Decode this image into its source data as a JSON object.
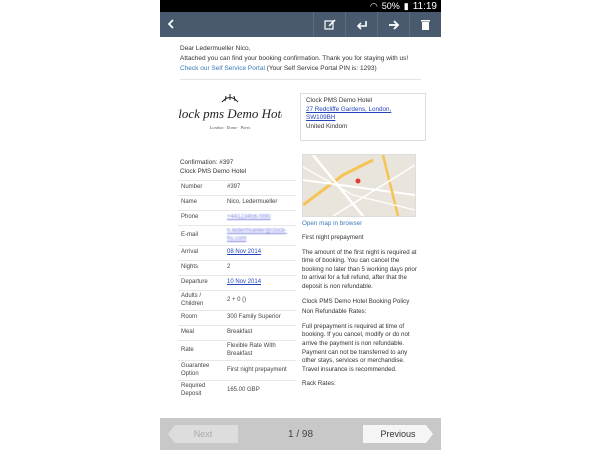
{
  "status": {
    "battery": "50%",
    "time": "11:19"
  },
  "toolbar": {
    "back_icon": "chevron-left-icon"
  },
  "email": {
    "greeting": "Dear Ledermueller Nico,",
    "intro": "Attached you can find your booking confirmation. Thank you for staying with us!",
    "portal_link": "Check our Self Service Portal",
    "portal_pin": " (Your Self Service Portal PIN is: 1293)"
  },
  "hotel": {
    "logo_text": "Clock pms Demo Hotel",
    "logo_sub": "London · Rome · Paris",
    "name": "Clock PMS Demo Hotel",
    "address_line1": "27 Redcliffe Gardens, London,",
    "address_line2": "SW109BH",
    "country": "United Kindom"
  },
  "confirmation": {
    "number_label": "Confirmation: #397",
    "hotel": "Clock PMS Demo Hotel"
  },
  "details": [
    {
      "key": "Number",
      "value": "#397"
    },
    {
      "key": "Name",
      "value": "Nico, Ledermueller"
    },
    {
      "key": "Phone",
      "value": "+441234567890"
    },
    {
      "key": "E-mail",
      "value": "n.ledermueller@clock-hs.com"
    },
    {
      "key": "Arrival",
      "value": "08 Nov 2014"
    },
    {
      "key": "Nights",
      "value": "2"
    },
    {
      "key": "Departure",
      "value": "10 Nov 2014"
    },
    {
      "key": "Adults / Children",
      "value": "2 + 0 ()"
    },
    {
      "key": "Room",
      "value": "300 Family Superior"
    },
    {
      "key": "Meal",
      "value": "Breakfast"
    },
    {
      "key": "Rate",
      "value": "Flexible Rate With Breakfast"
    },
    {
      "key": "Guarantee Option",
      "value": "First night prepayment"
    },
    {
      "key": "Required Deposit",
      "value": "165.00 GBP"
    }
  ],
  "map": {
    "caption": "Open map in browser"
  },
  "policy": {
    "heading": "First night prepayment",
    "text": "The amount of the first night is required at time of booking. You can cancel the booking no later than 5 working days prior to arrival for a full refund, after that the deposit is non refundable.",
    "booking_policy": "Clock PMS Demo Hotel Booking Policy",
    "non_refundable": "Non Refundable Rates:",
    "non_ref_text": "Full prepayment is required at time of booking. If you cancel, modify or do not arrive the payment is non refundable. Payment can not be transferred to any other stays, services or merchandise. Travel insurance is recommended.",
    "rack": "Rack Rates:"
  },
  "pager": {
    "next": "Next",
    "page": "1 / 98",
    "previous": "Previous"
  }
}
